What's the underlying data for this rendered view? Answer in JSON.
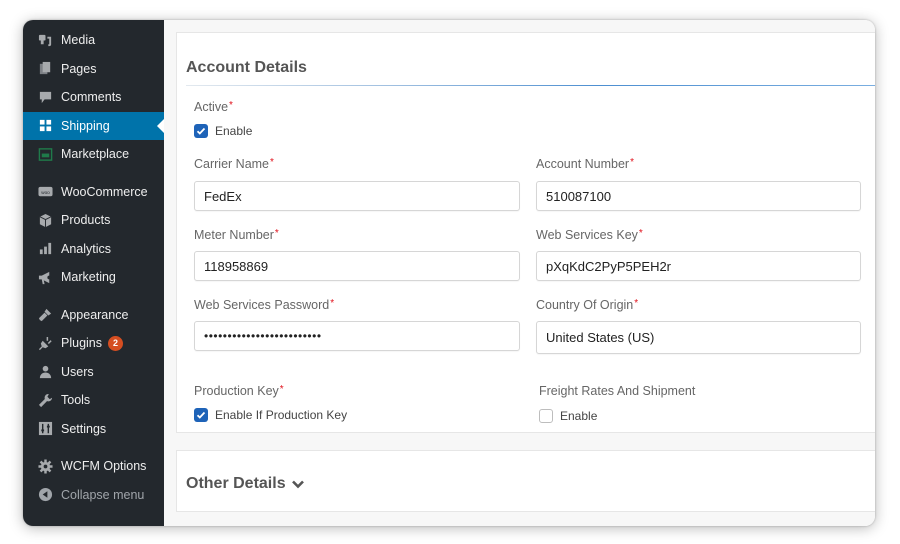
{
  "sidebar": {
    "items": [
      {
        "label": "Media",
        "icon": "media-icon"
      },
      {
        "label": "Pages",
        "icon": "pages-icon"
      },
      {
        "label": "Comments",
        "icon": "comments-icon"
      },
      {
        "label": "Shipping",
        "icon": "shipping-grid-icon",
        "active": true
      },
      {
        "label": "Marketplace",
        "icon": "marketplace-icon"
      },
      {
        "label": "WooCommerce",
        "icon": "woocommerce-icon"
      },
      {
        "label": "Products",
        "icon": "products-box-icon"
      },
      {
        "label": "Analytics",
        "icon": "analytics-bars-icon"
      },
      {
        "label": "Marketing",
        "icon": "megaphone-icon"
      },
      {
        "label": "Appearance",
        "icon": "paintbrush-icon"
      },
      {
        "label": "Plugins",
        "icon": "plugin-icon",
        "badge": "2"
      },
      {
        "label": "Users",
        "icon": "user-icon"
      },
      {
        "label": "Tools",
        "icon": "wrench-icon"
      },
      {
        "label": "Settings",
        "icon": "settings-sliders-icon"
      },
      {
        "label": "WCFM Options",
        "icon": "gear-icon"
      },
      {
        "label": "Collapse menu",
        "icon": "collapse-arrow-icon"
      }
    ]
  },
  "account": {
    "title": "Account Details",
    "active": {
      "label": "Active",
      "checkbox_label": "Enable",
      "checked": true
    },
    "carrier_name": {
      "label": "Carrier Name",
      "value": "FedEx"
    },
    "account_number": {
      "label": "Account Number",
      "value": "510087100"
    },
    "meter_number": {
      "label": "Meter Number",
      "value": "118958869"
    },
    "web_services_key": {
      "label": "Web Services Key",
      "value": "pXqKdC2PyP5PEH2r"
    },
    "web_services_password": {
      "label": "Web Services Password",
      "value": "•••••••••••••••••••••••••"
    },
    "country_of_origin": {
      "label": "Country Of Origin",
      "value": "United States (US)"
    },
    "production_key": {
      "label": "Production Key",
      "checkbox_label": "Enable If Production Key",
      "checked": true
    },
    "freight": {
      "label": "Freight Rates And Shipment",
      "checkbox_label": "Enable",
      "checked": false
    },
    "required_mark": "*"
  },
  "other": {
    "title": "Other Details"
  },
  "colors": {
    "sidebar_bg": "#23282d",
    "active_bg": "#0073aa",
    "checkbox_on": "#1e63b8",
    "badge": "#d54e21",
    "required": "#e0101a"
  }
}
